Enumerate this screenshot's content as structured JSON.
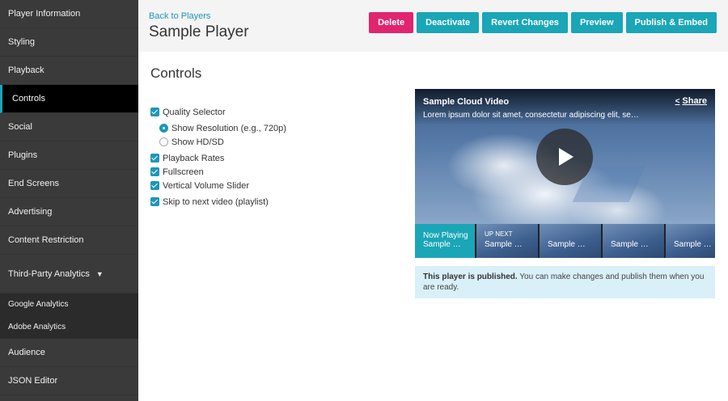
{
  "sidebar": {
    "items": [
      {
        "label": "Player Information"
      },
      {
        "label": "Styling"
      },
      {
        "label": "Playback"
      },
      {
        "label": "Controls"
      },
      {
        "label": "Social"
      },
      {
        "label": "Plugins"
      },
      {
        "label": "End Screens"
      },
      {
        "label": "Advertising"
      },
      {
        "label": "Content Restriction"
      },
      {
        "label": "Third-Party Analytics",
        "caret": "▼"
      }
    ],
    "sub_items": [
      {
        "label": "Google Analytics"
      },
      {
        "label": "Adobe Analytics"
      }
    ],
    "bottom_items": [
      {
        "label": "Audience"
      },
      {
        "label": "JSON Editor"
      }
    ]
  },
  "header": {
    "back_link": "Back to Players",
    "title": "Sample Player",
    "buttons": {
      "delete": "Delete",
      "deactivate": "Deactivate",
      "revert": "Revert Changes",
      "preview": "Preview",
      "publish": "Publish & Embed"
    }
  },
  "section": {
    "title": "Controls",
    "options": {
      "quality_selector": "Quality Selector",
      "show_resolution": "Show Resolution (e.g., 720p)",
      "show_hdsd": "Show HD/SD",
      "playback_rates": "Playback Rates",
      "fullscreen": "Fullscreen",
      "vertical_volume": "Vertical Volume Slider",
      "skip_next": "Skip to next video (playlist)"
    }
  },
  "player": {
    "title": "Sample Cloud Video",
    "description": "Lorem ipsum dolor sit amet, consectetur adipiscing elit, se…",
    "share": "Share",
    "thumbs": {
      "now_playing_top": "Now Playing",
      "now_playing_title": "Sample …",
      "up_next_label": "UP NEXT",
      "up_next_title": "Sample …",
      "t3": "Sample …",
      "t4": "Sample …",
      "t5": "Sample …"
    }
  },
  "notice": {
    "bold": "This player is published.",
    "text": " You can make changes and publish them when you are ready."
  },
  "colors": {
    "accent": "#1aa6b7",
    "danger": "#e1246f",
    "sidebar": "#3a3a3a"
  }
}
